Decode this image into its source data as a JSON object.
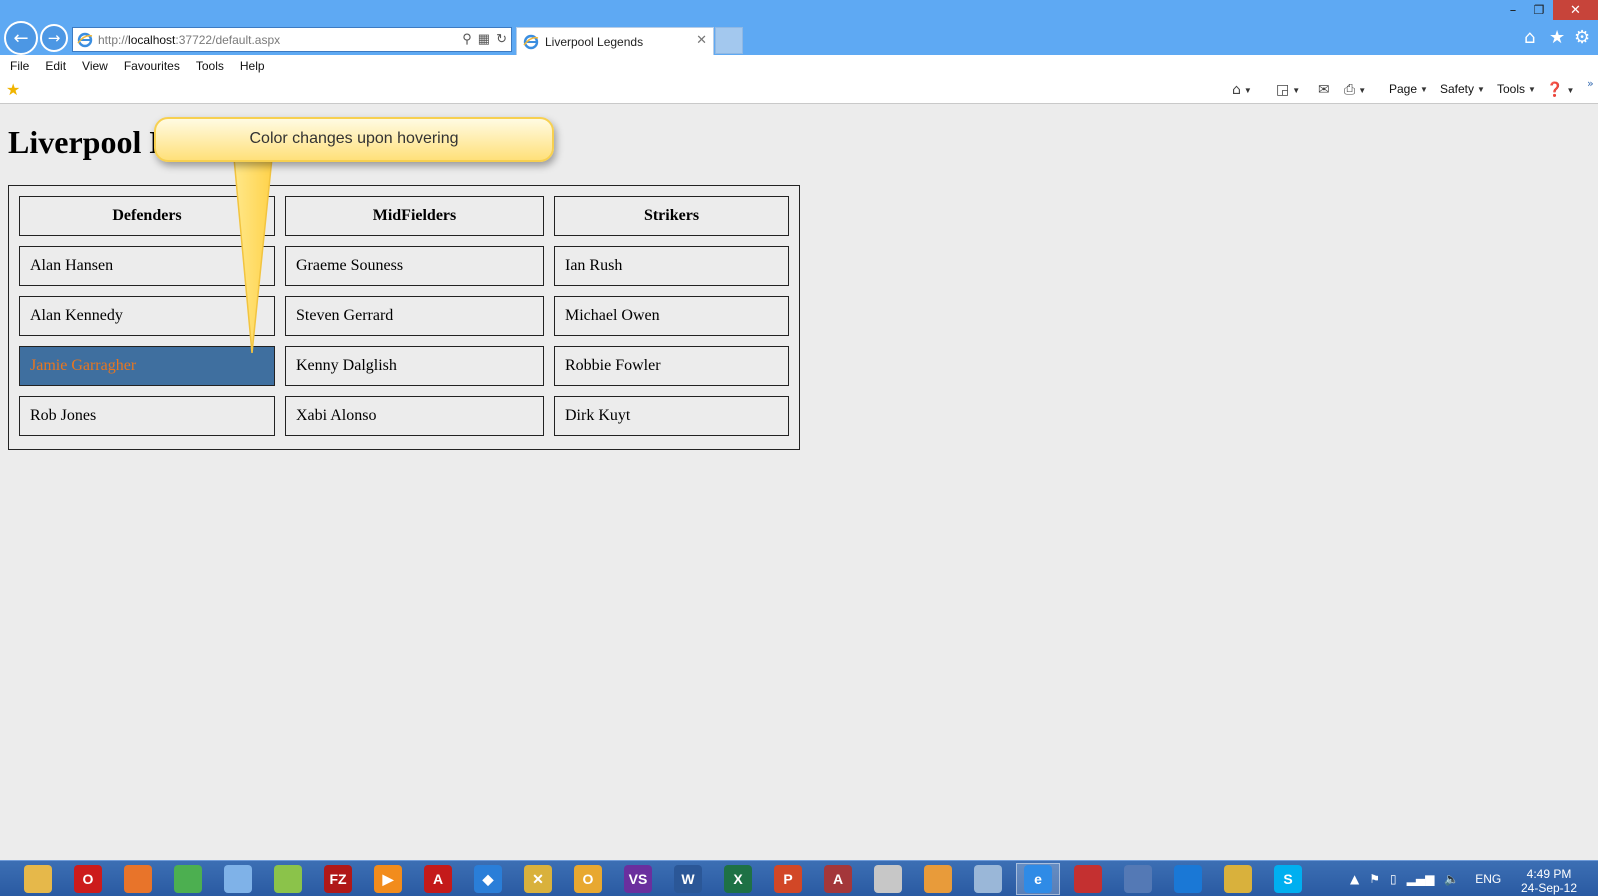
{
  "window": {
    "address_scheme": "http://",
    "address_host": "localhost",
    "address_rest": ":37722/default.aspx",
    "tab_title": "Liverpool Legends",
    "minimize_label": "–",
    "maximize_label": "❐",
    "close_label": "✕"
  },
  "menu": [
    "File",
    "Edit",
    "View",
    "Favourites",
    "Tools",
    "Help"
  ],
  "commandbar": {
    "page_label": "Page",
    "safety_label": "Safety",
    "tools_label": "Tools"
  },
  "page": {
    "heading": "Liverpool Legends",
    "callout_text": "Color changes upon hovering",
    "columns": [
      "Defenders",
      "MidFielders",
      "Strikers"
    ],
    "rows": [
      [
        "Alan Hansen",
        "Graeme Souness",
        "Ian Rush"
      ],
      [
        "Alan Kennedy",
        "Steven Gerrard",
        "Michael Owen"
      ],
      [
        "Jamie Garragher",
        "Kenny Dalglish",
        "Robbie Fowler"
      ],
      [
        "Rob Jones",
        "Xabi Alonso",
        "Dirk Kuyt"
      ]
    ],
    "hovered_cell": "Jamie Garragher",
    "hover_background": "#3f6f9f",
    "hover_text_color": "#e8761f"
  },
  "taskbar": {
    "apps": [
      {
        "name": "file-explorer",
        "color": "#e6b84a",
        "glyph": ""
      },
      {
        "name": "opera",
        "color": "#cc1b1b",
        "glyph": "O"
      },
      {
        "name": "firefox",
        "color": "#e8742a",
        "glyph": ""
      },
      {
        "name": "chrome",
        "color": "#4caf50",
        "glyph": ""
      },
      {
        "name": "paint",
        "color": "#7fb2e8",
        "glyph": ""
      },
      {
        "name": "sketch-tool",
        "color": "#8bc34a",
        "glyph": ""
      },
      {
        "name": "filezilla",
        "color": "#b01818",
        "glyph": "FZ"
      },
      {
        "name": "media-player",
        "color": "#f28c1c",
        "glyph": "▶"
      },
      {
        "name": "adobe-reader",
        "color": "#c41a1a",
        "glyph": "A"
      },
      {
        "name": "dropbox",
        "color": "#2a7ed8",
        "glyph": "◆"
      },
      {
        "name": "tools",
        "color": "#d9b13c",
        "glyph": "✕"
      },
      {
        "name": "outlook",
        "color": "#e8a830",
        "glyph": "O"
      },
      {
        "name": "visual-studio",
        "color": "#6a2f9e",
        "glyph": "VS"
      },
      {
        "name": "word",
        "color": "#2b5797",
        "glyph": "W"
      },
      {
        "name": "excel",
        "color": "#1e7145",
        "glyph": "X"
      },
      {
        "name": "powerpoint",
        "color": "#d24726",
        "glyph": "P"
      },
      {
        "name": "access",
        "color": "#a4373a",
        "glyph": "A"
      },
      {
        "name": "notepad",
        "color": "#c7c7c7",
        "glyph": ""
      },
      {
        "name": "palette",
        "color": "#e89b3a",
        "glyph": ""
      },
      {
        "name": "network",
        "color": "#9ab7d8",
        "glyph": ""
      },
      {
        "name": "internet-explorer",
        "color": "#2f8be6",
        "glyph": "e"
      },
      {
        "name": "snipping",
        "color": "#c43030",
        "glyph": ""
      },
      {
        "name": "tablet",
        "color": "#5479b5",
        "glyph": ""
      },
      {
        "name": "teamviewer",
        "color": "#1a78d6",
        "glyph": ""
      },
      {
        "name": "build-tools",
        "color": "#d9b13c",
        "glyph": ""
      },
      {
        "name": "skype",
        "color": "#00aff0",
        "glyph": "S"
      }
    ],
    "language": "ENG",
    "time": "4:49 PM",
    "date": "24-Sep-12"
  }
}
